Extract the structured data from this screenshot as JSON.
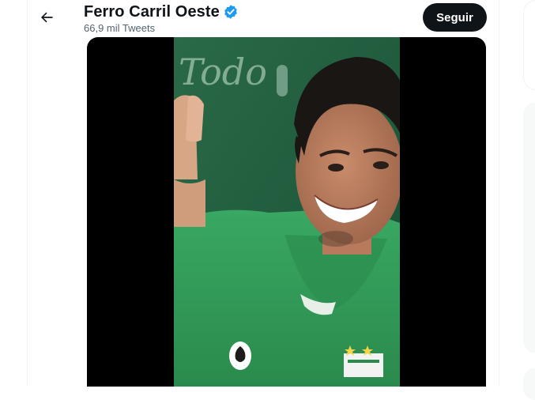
{
  "header": {
    "title": "Ferro Carril Oeste",
    "subtitle": "66,9 mil Tweets",
    "follow_label": "Seguir",
    "back_icon": "arrow-left-icon",
    "verified_icon": "verified-badge-icon"
  },
  "colors": {
    "text_primary": "#0f1419",
    "text_secondary": "#536471",
    "verified": "#1d9bf0",
    "follow_bg": "#0f1419",
    "jersey_green": "#2f9a56"
  },
  "media": {
    "type": "video",
    "wall_text": "Todo"
  }
}
